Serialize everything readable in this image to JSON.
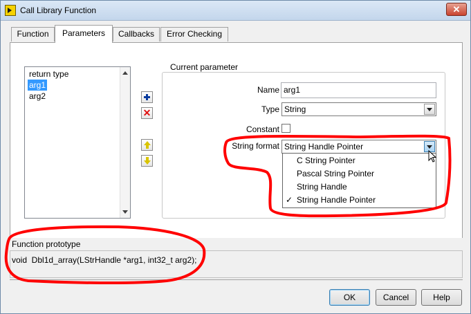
{
  "window": {
    "title": "Call Library Function",
    "close_glyph": "✕"
  },
  "tabs": [
    {
      "label": "Function"
    },
    {
      "label": "Parameters"
    },
    {
      "label": "Callbacks"
    },
    {
      "label": "Error Checking"
    }
  ],
  "parameter_list": {
    "items": [
      "return type",
      "arg1",
      "arg2"
    ],
    "selected": "arg1"
  },
  "current_parameter": {
    "legend": "Current parameter",
    "name_label": "Name",
    "name_value": "arg1",
    "type_label": "Type",
    "type_value": "String",
    "constant_label": "Constant",
    "constant_checked": false,
    "string_format_label": "String format",
    "string_format_value": "String Handle Pointer",
    "string_format_options": [
      "C String Pointer",
      "Pascal String Pointer",
      "String Handle",
      "String Handle Pointer"
    ],
    "check_glyph": "✓"
  },
  "side_buttons": {
    "remove_glyph": "✕"
  },
  "prototype": {
    "label": "Function prototype",
    "text": "void  Dbl1d_array(LStrHandle *arg1, int32_t arg2);"
  },
  "buttons": {
    "ok": "OK",
    "cancel": "Cancel",
    "help": "Help"
  },
  "colors": {
    "selection": "#3399ff",
    "annotation": "#ff0000",
    "add_icon": "#0a3b9e",
    "remove_icon": "#e01010",
    "move_arrows": "#d9c400"
  }
}
